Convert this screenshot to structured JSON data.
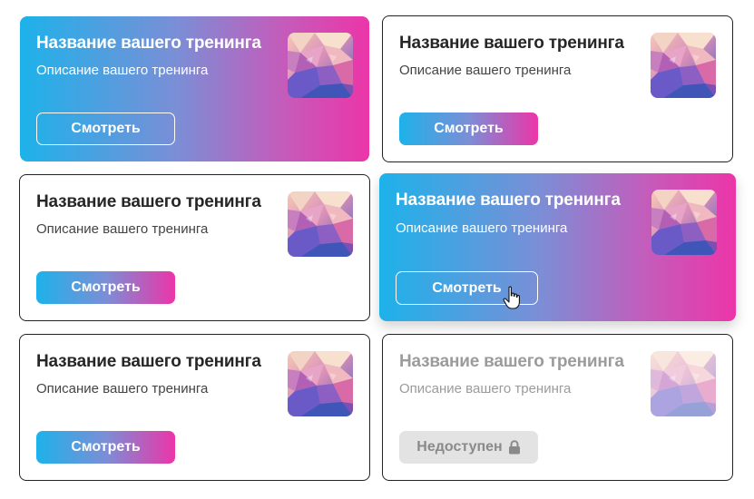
{
  "cards": [
    {
      "title": "Название вашего тренинга",
      "description": "Описание вашего тренинга",
      "button_label": "Смотреть",
      "state": "filled"
    },
    {
      "title": "Название вашего тренинга",
      "description": "Описание вашего тренинга",
      "button_label": "Смотреть",
      "state": "outline"
    },
    {
      "title": "Название вашего тренинга",
      "description": "Описание вашего тренинга",
      "button_label": "Смотреть",
      "state": "outline"
    },
    {
      "title": "Название вашего тренинга",
      "description": "Описание вашего тренинга",
      "button_label": "Смотреть",
      "state": "hover"
    },
    {
      "title": "Название вашего тренинга",
      "description": "Описание вашего тренинга",
      "button_label": "Смотреть",
      "state": "outline"
    },
    {
      "title": "Название вашего тренинга",
      "description": "Описание вашего тренинга",
      "button_label": "Недоступен",
      "state": "disabled",
      "button_icon": "lock-icon"
    }
  ],
  "colors": {
    "gradient_start": "#1db2ea",
    "gradient_end": "#ec35a8",
    "border": "#222222",
    "disabled_bg": "#e3e3e3",
    "disabled_text": "#8a8a8a"
  }
}
